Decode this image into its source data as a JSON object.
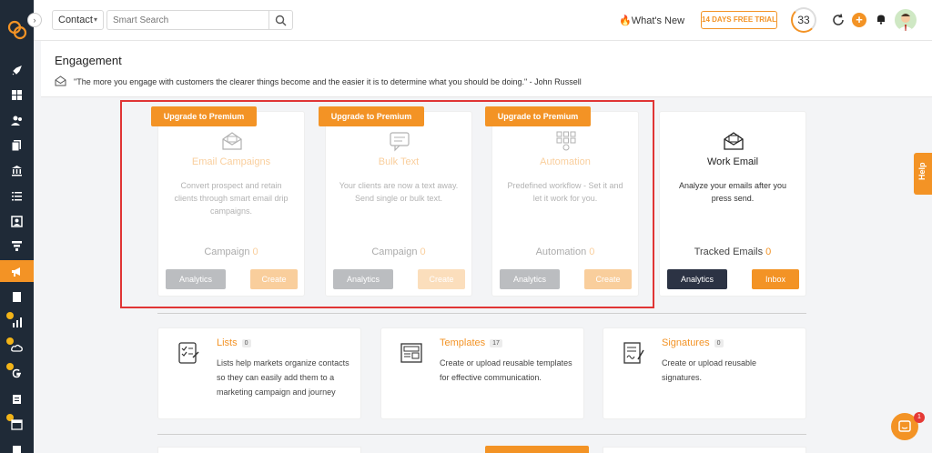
{
  "topbar": {
    "contact_select": "Contact",
    "search_placeholder": "Smart Search",
    "whats_new": "What's New",
    "trial": "14 DAYS FREE TRIAL",
    "notification_count": "33"
  },
  "header": {
    "title": "Engagement",
    "quote": "\"The more you engage with customers the clearer things become and the easier it is to determine what you should be doing.\" - John Russell"
  },
  "cards": [
    {
      "upgrade": "Upgrade to Premium",
      "title": "Email Campaigns",
      "desc": "Convert prospect and retain clients through smart email drip campaigns.",
      "count_label": "Campaign",
      "count": "0",
      "analytics": "Analytics",
      "action": "Create",
      "icon": "email-campaign-icon"
    },
    {
      "upgrade": "Upgrade to Premium",
      "title": "Bulk Text",
      "desc": "Your clients are now a text away. Send single or bulk text.",
      "count_label": "Campaign",
      "count": "0",
      "analytics": "Analytics",
      "action": "Create",
      "icon": "chat-bubble-icon"
    },
    {
      "upgrade": "Upgrade to Premium",
      "title": "Automation",
      "desc": "Predefined workflow - Set it and let it work for you.",
      "count_label": "Automation",
      "count": "0",
      "analytics": "Analytics",
      "action": "Create",
      "icon": "workflow-icon"
    },
    {
      "title": "Work Email",
      "desc": "Analyze your emails after you press send.",
      "count_label": "Tracked Emails",
      "count": "0",
      "analytics": "Analytics",
      "action": "Inbox",
      "icon": "work-email-icon"
    }
  ],
  "features": [
    {
      "title": "Lists",
      "badge": "0",
      "desc": "Lists help markets organize contacts so they can easily add them to a marketing campaign and journey",
      "icon": "checklist-icon"
    },
    {
      "title": "Templates",
      "badge": "17",
      "desc": "Create or upload reusable templates for effective communication.",
      "icon": "template-icon"
    },
    {
      "title": "Signatures",
      "badge": "0",
      "desc": "Create or upload reusable signatures.",
      "icon": "signature-icon"
    }
  ],
  "help": "Help",
  "chat_badge": "1",
  "colors": {
    "accent": "#f39325",
    "sidebar": "#1f2a37",
    "highlight": "#e03535"
  }
}
